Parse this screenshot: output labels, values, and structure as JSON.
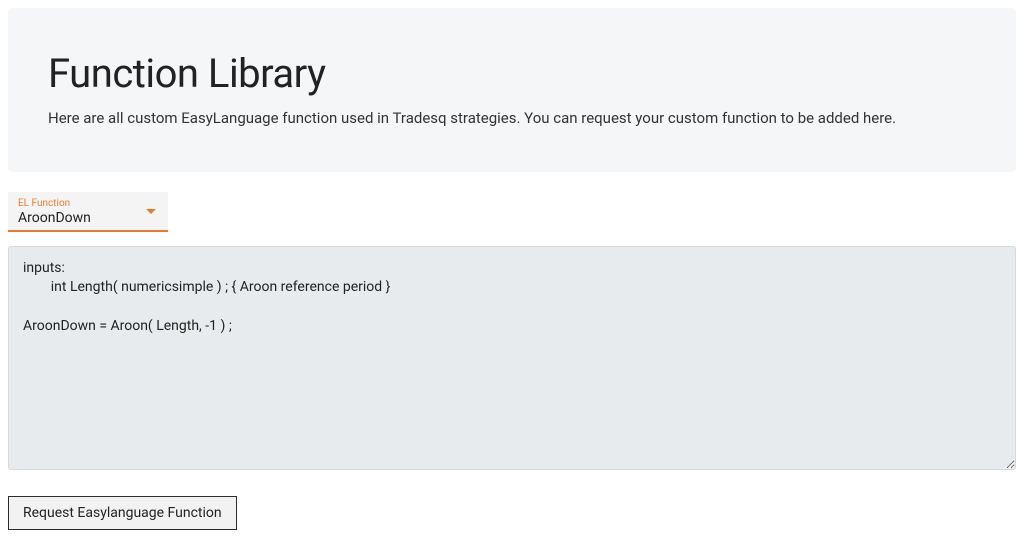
{
  "header": {
    "title": "Function Library",
    "subtitle": "Here are all custom EasyLanguage function used in Tradesq strategies. You can request your custom function to be added here."
  },
  "select": {
    "label": "EL Function",
    "value": "AroonDown"
  },
  "code": {
    "content": "inputs:\n        int Length( numericsimple ) ; { Aroon reference period }\n\nAroonDown = Aroon( Length, -1 ) ;"
  },
  "actions": {
    "request_label": "Request Easylanguage Function"
  }
}
